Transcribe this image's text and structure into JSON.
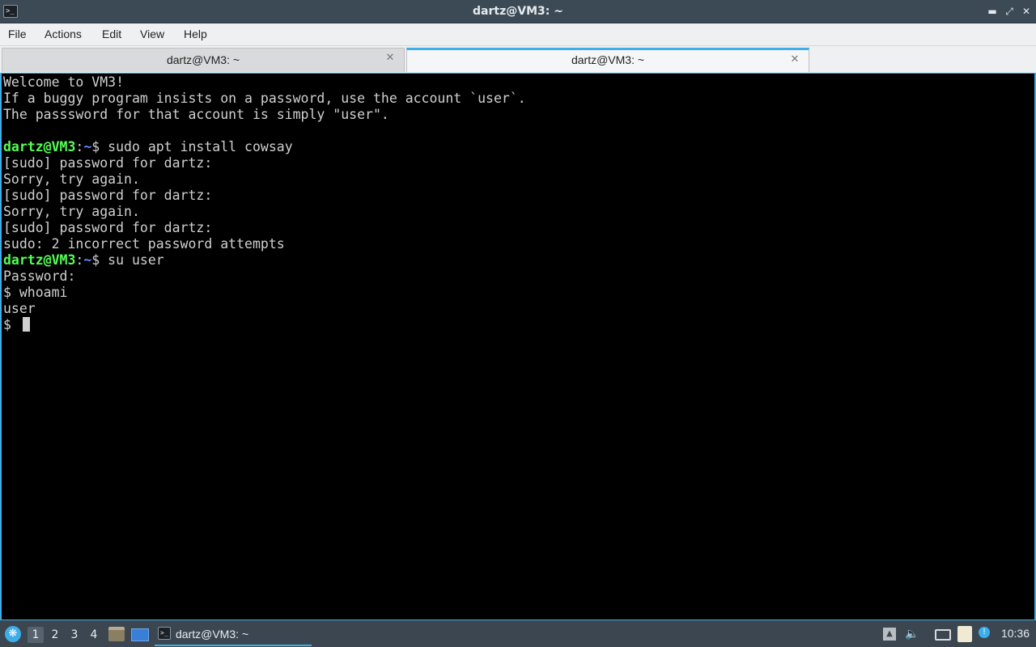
{
  "window": {
    "title": "dartz@VM3: ~"
  },
  "menu": [
    "File",
    "Actions",
    "Edit",
    "View",
    "Help"
  ],
  "tabs": [
    {
      "label": "dartz@VM3: ~",
      "active": false
    },
    {
      "label": "dartz@VM3: ~",
      "active": true
    }
  ],
  "terminal": {
    "lines": [
      "Welcome to VM3!",
      "If a buggy program insists on a password, use the account `user`.",
      "The passsword for that account is simply \"user\".",
      "",
      "",
      "[sudo] password for dartz:",
      "Sorry, try again.",
      "[sudo] password for dartz:",
      "Sorry, try again.",
      "[sudo] password for dartz:",
      "sudo: 2 incorrect password attempts",
      "",
      "Password:",
      "$ whoami",
      "user",
      "$ "
    ],
    "prompt1": {
      "user": "dartz@VM3",
      "sep": ":",
      "path": "~",
      "cmd": "$ sudo apt install cowsay"
    },
    "prompt2": {
      "user": "dartz@VM3",
      "sep": ":",
      "path": "~",
      "cmd": "$ su user"
    }
  },
  "taskbar": {
    "desktops": [
      "1",
      "2",
      "3",
      "4"
    ],
    "task_label": "dartz@VM3: ~",
    "clock": "10:36"
  },
  "colors": {
    "accent": "#3daee9",
    "prompt_user": "#54ff54",
    "prompt_path": "#5c8cff"
  }
}
